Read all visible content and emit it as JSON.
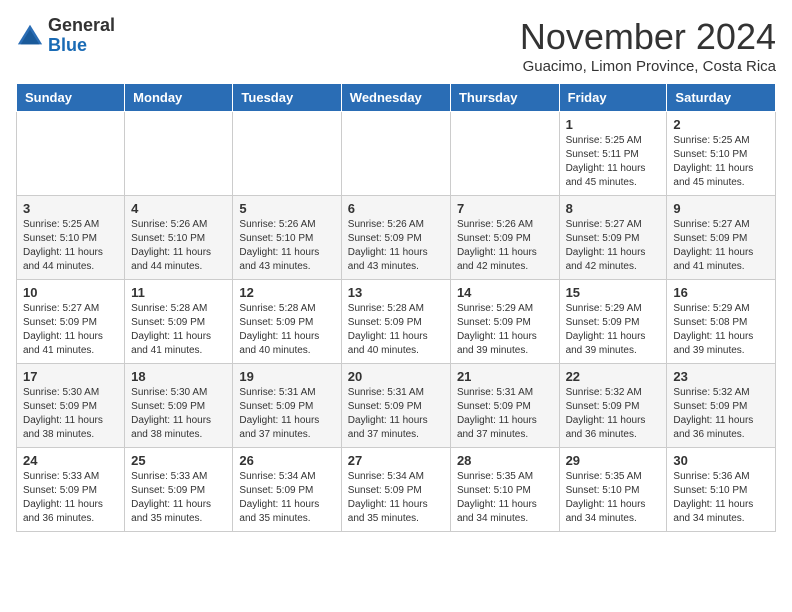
{
  "header": {
    "logo_general": "General",
    "logo_blue": "Blue",
    "month_title": "November 2024",
    "location": "Guacimo, Limon Province, Costa Rica"
  },
  "calendar": {
    "days_of_week": [
      "Sunday",
      "Monday",
      "Tuesday",
      "Wednesday",
      "Thursday",
      "Friday",
      "Saturday"
    ],
    "weeks": [
      [
        {
          "day": "",
          "info": ""
        },
        {
          "day": "",
          "info": ""
        },
        {
          "day": "",
          "info": ""
        },
        {
          "day": "",
          "info": ""
        },
        {
          "day": "",
          "info": ""
        },
        {
          "day": "1",
          "info": "Sunrise: 5:25 AM\nSunset: 5:11 PM\nDaylight: 11 hours and 45 minutes."
        },
        {
          "day": "2",
          "info": "Sunrise: 5:25 AM\nSunset: 5:10 PM\nDaylight: 11 hours and 45 minutes."
        }
      ],
      [
        {
          "day": "3",
          "info": "Sunrise: 5:25 AM\nSunset: 5:10 PM\nDaylight: 11 hours and 44 minutes."
        },
        {
          "day": "4",
          "info": "Sunrise: 5:26 AM\nSunset: 5:10 PM\nDaylight: 11 hours and 44 minutes."
        },
        {
          "day": "5",
          "info": "Sunrise: 5:26 AM\nSunset: 5:10 PM\nDaylight: 11 hours and 43 minutes."
        },
        {
          "day": "6",
          "info": "Sunrise: 5:26 AM\nSunset: 5:09 PM\nDaylight: 11 hours and 43 minutes."
        },
        {
          "day": "7",
          "info": "Sunrise: 5:26 AM\nSunset: 5:09 PM\nDaylight: 11 hours and 42 minutes."
        },
        {
          "day": "8",
          "info": "Sunrise: 5:27 AM\nSunset: 5:09 PM\nDaylight: 11 hours and 42 minutes."
        },
        {
          "day": "9",
          "info": "Sunrise: 5:27 AM\nSunset: 5:09 PM\nDaylight: 11 hours and 41 minutes."
        }
      ],
      [
        {
          "day": "10",
          "info": "Sunrise: 5:27 AM\nSunset: 5:09 PM\nDaylight: 11 hours and 41 minutes."
        },
        {
          "day": "11",
          "info": "Sunrise: 5:28 AM\nSunset: 5:09 PM\nDaylight: 11 hours and 41 minutes."
        },
        {
          "day": "12",
          "info": "Sunrise: 5:28 AM\nSunset: 5:09 PM\nDaylight: 11 hours and 40 minutes."
        },
        {
          "day": "13",
          "info": "Sunrise: 5:28 AM\nSunset: 5:09 PM\nDaylight: 11 hours and 40 minutes."
        },
        {
          "day": "14",
          "info": "Sunrise: 5:29 AM\nSunset: 5:09 PM\nDaylight: 11 hours and 39 minutes."
        },
        {
          "day": "15",
          "info": "Sunrise: 5:29 AM\nSunset: 5:09 PM\nDaylight: 11 hours and 39 minutes."
        },
        {
          "day": "16",
          "info": "Sunrise: 5:29 AM\nSunset: 5:08 PM\nDaylight: 11 hours and 39 minutes."
        }
      ],
      [
        {
          "day": "17",
          "info": "Sunrise: 5:30 AM\nSunset: 5:09 PM\nDaylight: 11 hours and 38 minutes."
        },
        {
          "day": "18",
          "info": "Sunrise: 5:30 AM\nSunset: 5:09 PM\nDaylight: 11 hours and 38 minutes."
        },
        {
          "day": "19",
          "info": "Sunrise: 5:31 AM\nSunset: 5:09 PM\nDaylight: 11 hours and 37 minutes."
        },
        {
          "day": "20",
          "info": "Sunrise: 5:31 AM\nSunset: 5:09 PM\nDaylight: 11 hours and 37 minutes."
        },
        {
          "day": "21",
          "info": "Sunrise: 5:31 AM\nSunset: 5:09 PM\nDaylight: 11 hours and 37 minutes."
        },
        {
          "day": "22",
          "info": "Sunrise: 5:32 AM\nSunset: 5:09 PM\nDaylight: 11 hours and 36 minutes."
        },
        {
          "day": "23",
          "info": "Sunrise: 5:32 AM\nSunset: 5:09 PM\nDaylight: 11 hours and 36 minutes."
        }
      ],
      [
        {
          "day": "24",
          "info": "Sunrise: 5:33 AM\nSunset: 5:09 PM\nDaylight: 11 hours and 36 minutes."
        },
        {
          "day": "25",
          "info": "Sunrise: 5:33 AM\nSunset: 5:09 PM\nDaylight: 11 hours and 35 minutes."
        },
        {
          "day": "26",
          "info": "Sunrise: 5:34 AM\nSunset: 5:09 PM\nDaylight: 11 hours and 35 minutes."
        },
        {
          "day": "27",
          "info": "Sunrise: 5:34 AM\nSunset: 5:09 PM\nDaylight: 11 hours and 35 minutes."
        },
        {
          "day": "28",
          "info": "Sunrise: 5:35 AM\nSunset: 5:10 PM\nDaylight: 11 hours and 34 minutes."
        },
        {
          "day": "29",
          "info": "Sunrise: 5:35 AM\nSunset: 5:10 PM\nDaylight: 11 hours and 34 minutes."
        },
        {
          "day": "30",
          "info": "Sunrise: 5:36 AM\nSunset: 5:10 PM\nDaylight: 11 hours and 34 minutes."
        }
      ]
    ]
  }
}
